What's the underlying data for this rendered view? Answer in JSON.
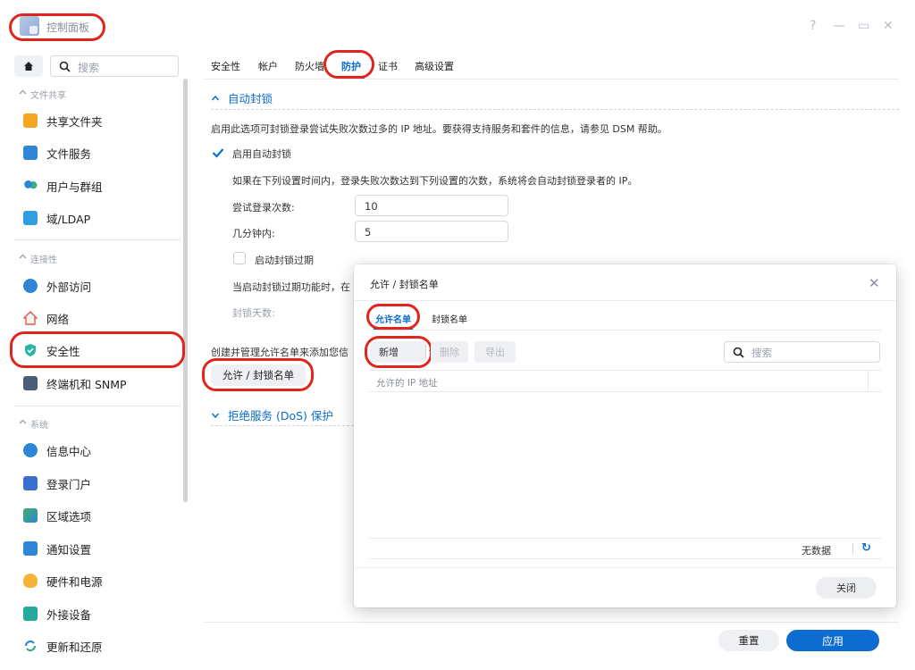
{
  "app": {
    "title": "控制面板"
  },
  "window_controls": {
    "help": "?",
    "minimize": "—",
    "maximize": "▭",
    "close": "✕"
  },
  "sidebar": {
    "search_placeholder": "搜索",
    "sections": [
      {
        "label": "文件共享",
        "items": [
          "共享文件夹",
          "文件服务",
          "用户与群组",
          "域/LDAP"
        ]
      },
      {
        "label": "连接性",
        "items": [
          "外部访问",
          "网络",
          "安全性",
          "终端机和 SNMP"
        ]
      },
      {
        "label": "系统",
        "items": [
          "信息中心",
          "登录门户",
          "区域选项",
          "通知设置",
          "硬件和电源",
          "外接设备",
          "更新和还原"
        ]
      }
    ],
    "selected": "安全性"
  },
  "tabs": [
    "安全性",
    "帐户",
    "防火墙",
    "防护",
    "证书",
    "高级设置"
  ],
  "active_tab": "防护",
  "auto_block": {
    "heading": "自动封锁",
    "description": "启用此选项可封锁登录尝试失败次数过多的 IP 地址。要获得支持服务和套件的信息，请参见 DSM 帮助。",
    "enable_label": "启用自动封锁",
    "enabled": true,
    "rule_text": "如果在下列设置时间内，登录失败次数达到下列设置的次数，系统将会自动封锁登录者的 IP。",
    "attempts_label": "尝试登录次数:",
    "attempts_value": "10",
    "minutes_label": "几分钟内:",
    "minutes_value": "5",
    "expire_label": "启动封锁过期",
    "expire_enabled": false,
    "expire_desc": "当启动封锁过期功能时，在",
    "days_label": "封锁天数:",
    "manage_text": "创建并管理允许名单来添加您信",
    "allow_block_button": "允许 / 封锁名单"
  },
  "dos": {
    "heading": "拒绝服务 (DoS) 保护"
  },
  "footer": {
    "reset": "重置",
    "apply": "应用"
  },
  "dialog": {
    "title": "允许 / 封锁名单",
    "tabs": [
      "允许名单",
      "封锁名单"
    ],
    "active_tab": "允许名单",
    "toolbar": {
      "add": "新增",
      "delete": "删除",
      "export": "导出",
      "search_placeholder": "搜索"
    },
    "column": "允许的 IP 地址",
    "no_data": "无数据",
    "close_button": "关闭"
  },
  "colors": {
    "accent": "#0d6ccf",
    "highlight": "#e0261c"
  }
}
